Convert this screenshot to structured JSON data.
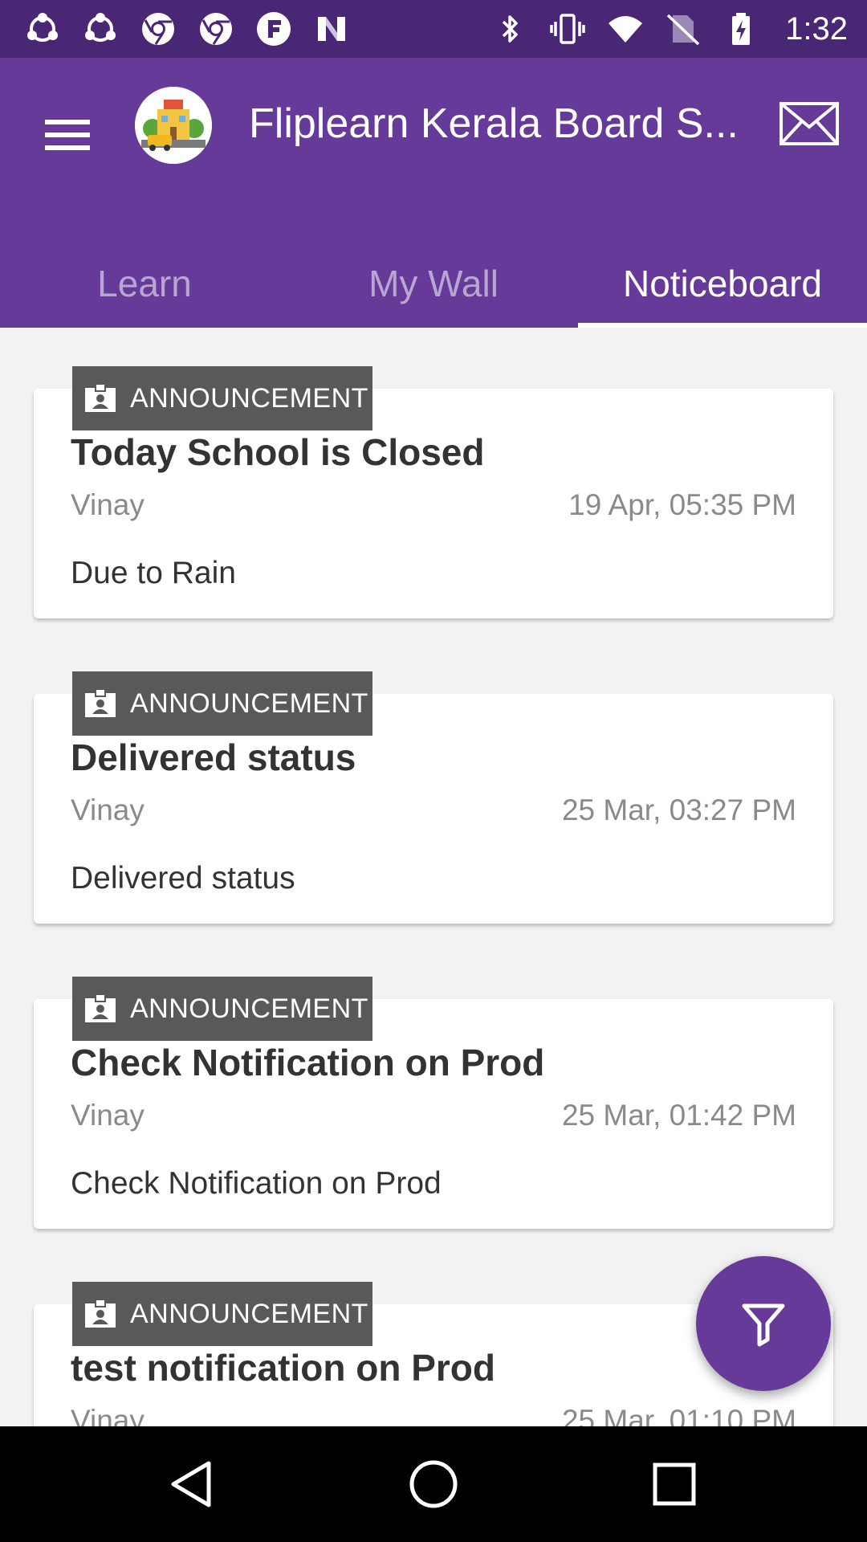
{
  "status_bar": {
    "time": "1:32",
    "left_icons": [
      "share-icon",
      "share-icon",
      "chrome-icon",
      "chrome-icon",
      "flipboard-icon",
      "n-icon"
    ],
    "right_icons": [
      "bluetooth-icon",
      "vibrate-icon",
      "wifi-icon",
      "no-sim-icon",
      "battery-charging-icon"
    ]
  },
  "app_bar": {
    "title": "Fliplearn Kerala Board S...",
    "menu_icon": "hamburger-menu-icon",
    "logo_icon": "school-logo-icon",
    "mail_icon": "mail-icon",
    "background_color": "#663a99"
  },
  "tabs": [
    {
      "label": "Learn",
      "active": false
    },
    {
      "label": "My Wall",
      "active": false
    },
    {
      "label": "Noticeboard",
      "active": true
    }
  ],
  "notices": [
    {
      "tag": "ANNOUNCEMENT",
      "title": "Today School is Closed",
      "author": "Vinay",
      "date": "19 Apr, 05:35 PM",
      "body": "Due to Rain"
    },
    {
      "tag": "ANNOUNCEMENT",
      "title": "Delivered status",
      "author": "Vinay",
      "date": "25 Mar, 03:27 PM",
      "body": "Delivered status"
    },
    {
      "tag": "ANNOUNCEMENT",
      "title": "Check Notification on Prod",
      "author": "Vinay",
      "date": "25 Mar, 01:42 PM",
      "body": "Check Notification on Prod"
    },
    {
      "tag": "ANNOUNCEMENT",
      "title": "test notification on Prod",
      "author": "Vinay",
      "date": "25 Mar, 01:10 PM",
      "body": ""
    }
  ],
  "fab": {
    "icon": "filter-icon"
  },
  "nav_bar": {
    "icons": [
      "back-icon",
      "home-icon",
      "recents-icon"
    ]
  }
}
